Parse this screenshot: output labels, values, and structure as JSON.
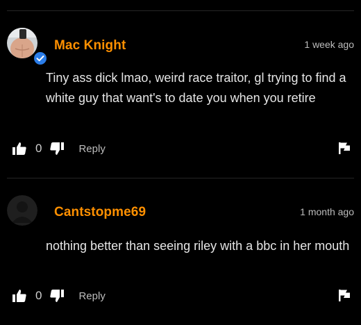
{
  "comments": [
    {
      "username": "Mac Knight",
      "verified": true,
      "avatar": "user-photo",
      "timestamp": "1 week ago",
      "text": "Tiny ass dick lmao, weird race traitor, gl trying to find a white guy that want's to date you when you retire",
      "likes": "0",
      "reply_label": "Reply"
    },
    {
      "username": "Cantstopme69",
      "verified": false,
      "avatar": "default-avatar-silhouette",
      "timestamp": "1 month ago",
      "text": "nothing better than seeing riley with a bbc in her mouth",
      "likes": "0",
      "reply_label": "Reply"
    }
  ],
  "colors": {
    "background": "#000000",
    "username": "#ff9000",
    "verified_badge": "#2b7de9",
    "text": "#e6e6e6",
    "muted": "#bdbdbd",
    "divider": "#262626"
  }
}
